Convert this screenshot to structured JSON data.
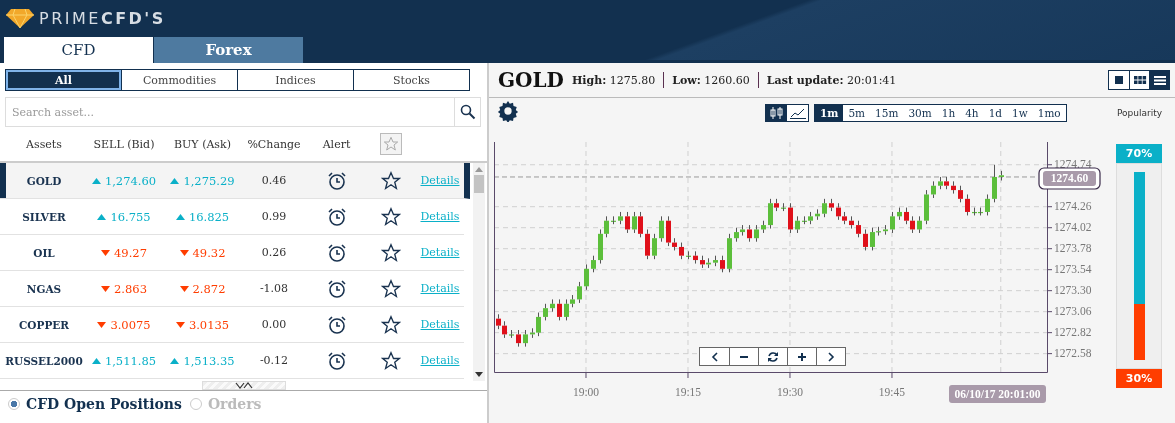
{
  "logo": {
    "text": "PRIME**CFD'S**"
  },
  "main_tabs": [
    {
      "label": "CFD",
      "selected": true
    },
    {
      "label": "Forex",
      "selected": false
    }
  ],
  "filters": [
    {
      "label": "All",
      "selected": true
    },
    {
      "label": "Commodities",
      "selected": false
    },
    {
      "label": "Indices",
      "selected": false
    },
    {
      "label": "Stocks",
      "selected": false
    }
  ],
  "search": {
    "placeholder": "Search asset..."
  },
  "table": {
    "columns": [
      "Assets",
      "SELL (Bid)",
      "BUY (Ask)",
      "%Change",
      "Alert"
    ],
    "rows": [
      {
        "asset": "GOLD",
        "sell": "1,274.60",
        "buy": "1,275.29",
        "up": true,
        "change": "0.46",
        "link": "Details",
        "selected": true
      },
      {
        "asset": "SILVER",
        "sell": "16.755",
        "buy": "16.825",
        "up": true,
        "change": "0.99",
        "link": "Details",
        "selected": false
      },
      {
        "asset": "OIL",
        "sell": "49.27",
        "buy": "49.32",
        "up": false,
        "change": "0.26",
        "link": "Details",
        "selected": false
      },
      {
        "asset": "NGAS",
        "sell": "2.863",
        "buy": "2.872",
        "up": false,
        "change": "-1.08",
        "link": "Details",
        "selected": false
      },
      {
        "asset": "COPPER",
        "sell": "3.0075",
        "buy": "3.0135",
        "up": false,
        "change": "0.00",
        "link": "Details",
        "selected": false
      },
      {
        "asset": "RUSSEL2000",
        "sell": "1,511.85",
        "buy": "1,513.35",
        "up": true,
        "change": "-0.12",
        "link": "Details",
        "selected": false
      }
    ]
  },
  "bottom_options": [
    {
      "label": "CFD Open Positions",
      "selected": true
    },
    {
      "label": "Orders",
      "selected": false
    }
  ],
  "instrument": {
    "name": "GOLD",
    "stats": [
      {
        "label": "High:",
        "value": "1275.80"
      },
      {
        "label": "Low:",
        "value": "1260.60"
      },
      {
        "label": "Last update:",
        "value": "20:01:41"
      }
    ]
  },
  "view_modes": [
    {
      "kind": "single",
      "selected": false
    },
    {
      "kind": "grid",
      "selected": false
    },
    {
      "kind": "list",
      "selected": true
    }
  ],
  "chart_types": [
    {
      "kind": "candles",
      "selected": true
    },
    {
      "kind": "line",
      "selected": false
    }
  ],
  "timeframes": [
    {
      "label": "1m",
      "selected": true
    },
    {
      "label": "5m",
      "selected": false
    },
    {
      "label": "15m",
      "selected": false
    },
    {
      "label": "30m",
      "selected": false
    },
    {
      "label": "1h",
      "selected": false
    },
    {
      "label": "4h",
      "selected": false
    },
    {
      "label": "1d",
      "selected": false
    },
    {
      "label": "1w",
      "selected": false
    },
    {
      "label": "1mo",
      "selected": false
    }
  ],
  "chart": {
    "time_badge": "06/10/17 20:01:00",
    "chart_data": {
      "type": "candlestick",
      "categories": [
        null,
        null,
        null,
        null,
        null,
        null,
        null,
        null,
        null,
        null,
        null,
        null,
        null,
        "19:00",
        null,
        null,
        null,
        null,
        null,
        null,
        null,
        null,
        null,
        null,
        null,
        null,
        null,
        null,
        "19:15",
        null,
        null,
        null,
        null,
        null,
        null,
        null,
        null,
        null,
        null,
        null,
        null,
        null,
        null,
        "19:30",
        null,
        null,
        null,
        null,
        null,
        null,
        null,
        null,
        null,
        null,
        null,
        null,
        null,
        null,
        "19:45",
        null,
        null,
        null,
        null,
        null,
        null,
        null,
        null,
        null,
        null,
        null,
        null,
        null,
        null,
        null,
        null
      ],
      "ohlc": [
        [
          1272.98,
          1273.03,
          1272.86,
          1272.9
        ],
        [
          1272.9,
          1272.95,
          1272.76,
          1272.8
        ],
        [
          1272.8,
          1272.85,
          1272.76,
          1272.8
        ],
        [
          1272.8,
          1272.85,
          1272.66,
          1272.7
        ],
        [
          1272.7,
          1272.85,
          1272.66,
          1272.8
        ],
        [
          1272.8,
          1272.87,
          1272.76,
          1272.82
        ],
        [
          1272.82,
          1273.05,
          1272.78,
          1273.0
        ],
        [
          1273.0,
          1273.15,
          1272.96,
          1273.1
        ],
        [
          1273.1,
          1273.2,
          1273.06,
          1273.15
        ],
        [
          1273.15,
          1273.2,
          1272.96,
          1273.0
        ],
        [
          1273.0,
          1273.2,
          1272.96,
          1273.15
        ],
        [
          1273.15,
          1273.25,
          1273.11,
          1273.2
        ],
        [
          1273.2,
          1273.4,
          1273.16,
          1273.35
        ],
        [
          1273.35,
          1273.6,
          1273.31,
          1273.55
        ],
        [
          1273.55,
          1273.7,
          1273.51,
          1273.65
        ],
        [
          1273.65,
          1274.0,
          1273.61,
          1273.95
        ],
        [
          1273.95,
          1274.15,
          1273.91,
          1274.1
        ],
        [
          1274.1,
          1274.15,
          1274.06,
          1274.1
        ],
        [
          1274.1,
          1274.2,
          1274.06,
          1274.15
        ],
        [
          1274.15,
          1274.2,
          1273.96,
          1274.0
        ],
        [
          1274.0,
          1274.2,
          1273.96,
          1274.15
        ],
        [
          1274.15,
          1274.2,
          1273.91,
          1273.95
        ],
        [
          1273.95,
          1274.0,
          1273.66,
          1273.7
        ],
        [
          1273.7,
          1273.95,
          1273.66,
          1273.9
        ],
        [
          1273.9,
          1274.15,
          1273.86,
          1274.1
        ],
        [
          1274.1,
          1274.15,
          1273.81,
          1273.85
        ],
        [
          1273.85,
          1273.9,
          1273.76,
          1273.8
        ],
        [
          1273.8,
          1273.85,
          1273.66,
          1273.7
        ],
        [
          1273.7,
          1273.75,
          1273.66,
          1273.7
        ],
        [
          1273.7,
          1273.75,
          1273.61,
          1273.65
        ],
        [
          1273.65,
          1273.7,
          1273.56,
          1273.6
        ],
        [
          1273.6,
          1273.67,
          1273.56,
          1273.62
        ],
        [
          1273.62,
          1273.7,
          1273.58,
          1273.65
        ],
        [
          1273.65,
          1273.7,
          1273.51,
          1273.55
        ],
        [
          1273.55,
          1273.95,
          1273.51,
          1273.9
        ],
        [
          1273.9,
          1274.02,
          1273.86,
          1273.97
        ],
        [
          1273.97,
          1274.05,
          1273.93,
          1274.0
        ],
        [
          1274.0,
          1274.05,
          1273.86,
          1273.9
        ],
        [
          1273.9,
          1274.05,
          1273.86,
          1274.0
        ],
        [
          1274.0,
          1274.1,
          1273.96,
          1274.05
        ],
        [
          1274.05,
          1274.35,
          1274.01,
          1274.3
        ],
        [
          1274.3,
          1274.35,
          1274.21,
          1274.25
        ],
        [
          1274.25,
          1274.3,
          1274.21,
          1274.25
        ],
        [
          1274.25,
          1274.3,
          1273.96,
          1274.0
        ],
        [
          1274.0,
          1274.15,
          1273.96,
          1274.1
        ],
        [
          1274.1,
          1274.15,
          1274.06,
          1274.1
        ],
        [
          1274.1,
          1274.2,
          1274.06,
          1274.15
        ],
        [
          1274.15,
          1274.23,
          1274.11,
          1274.18
        ],
        [
          1274.18,
          1274.35,
          1274.14,
          1274.3
        ],
        [
          1274.3,
          1274.35,
          1274.21,
          1274.25
        ],
        [
          1274.25,
          1274.3,
          1274.11,
          1274.15
        ],
        [
          1274.15,
          1274.2,
          1274.06,
          1274.1
        ],
        [
          1274.1,
          1274.15,
          1274.01,
          1274.05
        ],
        [
          1274.05,
          1274.1,
          1273.91,
          1273.95
        ],
        [
          1273.95,
          1274.0,
          1273.76,
          1273.8
        ],
        [
          1273.8,
          1274.02,
          1273.76,
          1273.97
        ],
        [
          1273.97,
          1274.03,
          1273.93,
          1273.98
        ],
        [
          1273.98,
          1274.05,
          1273.94,
          1274.0
        ],
        [
          1274.0,
          1274.2,
          1273.96,
          1274.15
        ],
        [
          1274.15,
          1274.25,
          1274.11,
          1274.2
        ],
        [
          1274.2,
          1274.25,
          1274.06,
          1274.1
        ],
        [
          1274.1,
          1274.15,
          1273.96,
          1274.0
        ],
        [
          1274.0,
          1274.15,
          1273.96,
          1274.1
        ],
        [
          1274.1,
          1274.45,
          1274.06,
          1274.4
        ],
        [
          1274.4,
          1274.55,
          1274.36,
          1274.5
        ],
        [
          1274.5,
          1274.6,
          1274.46,
          1274.55
        ],
        [
          1274.55,
          1274.6,
          1274.46,
          1274.5
        ],
        [
          1274.5,
          1274.55,
          1274.41,
          1274.45
        ],
        [
          1274.45,
          1274.5,
          1274.31,
          1274.35
        ],
        [
          1274.35,
          1274.4,
          1274.16,
          1274.2
        ],
        [
          1274.2,
          1274.25,
          1274.16,
          1274.2
        ],
        [
          1274.2,
          1274.25,
          1274.16,
          1274.2
        ],
        [
          1274.2,
          1274.4,
          1274.16,
          1274.35
        ],
        [
          1274.35,
          1274.74,
          1274.31,
          1274.6
        ],
        [
          1274.6,
          1274.67,
          1274.56,
          1274.62
        ]
      ],
      "ylim": [
        1272.37,
        1275.0
      ],
      "grid": true,
      "ref_lines": [
        {
          "axis": "y",
          "value": 1274.6,
          "label": "1274.60"
        }
      ],
      "yticks": [
        {
          "value": 1274.74,
          "label": "1274.74"
        },
        {
          "value": 1274.26,
          "label": "1274.26"
        },
        {
          "value": 1274.02,
          "label": "1274.02"
        },
        {
          "value": 1273.78,
          "label": "1273.78"
        },
        {
          "value": 1273.54,
          "label": "1273.54"
        },
        {
          "value": 1273.3,
          "label": "1273.30"
        },
        {
          "value": 1273.06,
          "label": "1273.06"
        },
        {
          "value": 1272.82,
          "label": "1272.82"
        },
        {
          "value": 1272.58,
          "label": "1272.58"
        }
      ]
    }
  },
  "popularity": {
    "label": "Popularity",
    "buy": {
      "text": "70%",
      "level": 0.7
    },
    "sell": {
      "text": "30%",
      "level": 0.3
    }
  }
}
